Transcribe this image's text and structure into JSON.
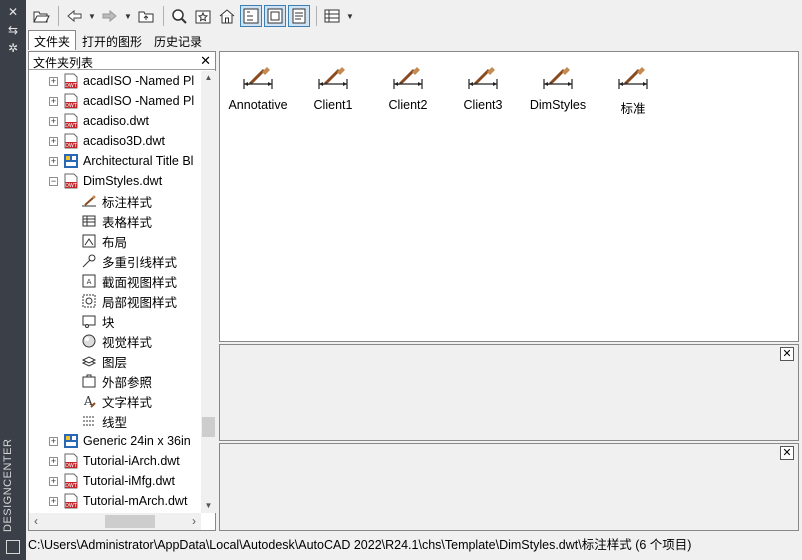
{
  "sidebar_strip": {
    "label": "DESIGNCENTER",
    "buttons": [
      "✕",
      "⇆",
      "✲"
    ]
  },
  "toolbar": {
    "icons": [
      "load-icon",
      "back-icon",
      "forward-icon",
      "up-icon",
      "search-icon",
      "favorites-icon",
      "home-icon",
      "tree-toggle-icon",
      "preview-icon",
      "description-icon",
      "views-icon"
    ]
  },
  "tabs": [
    {
      "label": "文件夹",
      "active": true
    },
    {
      "label": "打开的图形",
      "active": false
    },
    {
      "label": "历史记录",
      "active": false
    }
  ],
  "tree_panel": {
    "header": "文件夹列表",
    "close": "✕",
    "nodes": [
      {
        "label": "acadISO -Named Pl",
        "type": "dwt",
        "expander": "+"
      },
      {
        "label": "acadISO -Named Pl",
        "type": "dwt",
        "expander": "+"
      },
      {
        "label": "acadiso.dwt",
        "type": "dwt",
        "expander": "+"
      },
      {
        "label": "acadiso3D.dwt",
        "type": "dwt",
        "expander": "+"
      },
      {
        "label": "Architectural Title Bl",
        "type": "arch",
        "expander": "+"
      },
      {
        "label": "DimStyles.dwt",
        "type": "dwt",
        "expander": "−"
      },
      {
        "label": "标注样式",
        "type": "child",
        "icon": "dimstyle-icon"
      },
      {
        "label": "表格样式",
        "type": "child",
        "icon": "table-style-icon"
      },
      {
        "label": "布局",
        "type": "child",
        "icon": "layout-icon"
      },
      {
        "label": "多重引线样式",
        "type": "child",
        "icon": "mleader-icon"
      },
      {
        "label": "截面视图样式",
        "type": "child",
        "icon": "section-view-icon"
      },
      {
        "label": "局部视图样式",
        "type": "child",
        "icon": "detail-view-icon"
      },
      {
        "label": "块",
        "type": "child",
        "icon": "block-icon"
      },
      {
        "label": "视觉样式",
        "type": "child",
        "icon": "visual-style-icon"
      },
      {
        "label": "图层",
        "type": "child",
        "icon": "layer-icon"
      },
      {
        "label": "外部参照",
        "type": "child",
        "icon": "xref-icon"
      },
      {
        "label": "文字样式",
        "type": "child",
        "icon": "text-style-icon"
      },
      {
        "label": "线型",
        "type": "child",
        "icon": "linetype-icon"
      },
      {
        "label": "Generic 24in x 36in",
        "type": "arch",
        "expander": "+"
      },
      {
        "label": "Tutorial-iArch.dwt",
        "type": "dwt",
        "expander": "+"
      },
      {
        "label": "Tutorial-iMfg.dwt",
        "type": "dwt",
        "expander": "+"
      },
      {
        "label": "Tutorial-mArch.dwt",
        "type": "dwt",
        "expander": "+"
      }
    ]
  },
  "content": {
    "items": [
      "Annotative",
      "Client1",
      "Client2",
      "Client3",
      "DimStyles",
      "标准"
    ]
  },
  "preview_close": "✕",
  "desc_close": "✕",
  "status": "C:\\Users\\Administrator\\AppData\\Local\\Autodesk\\AutoCAD 2022\\R24.1\\chs\\Template\\DimStyles.dwt\\标注样式 (6 个项目)",
  "colors": {
    "strip": "#3a3f48",
    "dwt_red": "#c4262e",
    "active_toggle": "#cfe3f5",
    "brush_brown": "#8b4a1e"
  }
}
